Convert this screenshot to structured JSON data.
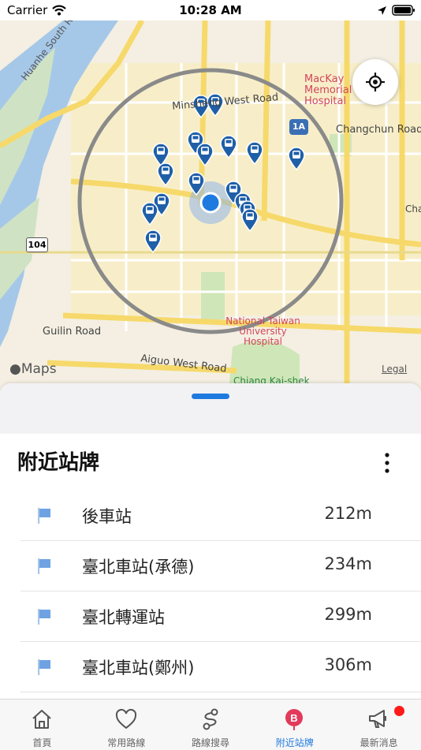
{
  "status_bar": {
    "carrier": "Carrier",
    "time": "10:28 AM"
  },
  "map": {
    "street_labels": [
      "Huanhe South Road",
      "Minsheng West Road",
      "MacKay Memorial Hospital",
      "Changchun Road",
      "Guilin Road",
      "Aiguo West Road",
      "National Taiwan University Hospital",
      "Chiang Kai-shek",
      "Cha"
    ],
    "route_shield": "104",
    "highway_shield": "1A",
    "attribution": "Maps",
    "legal": "Legal"
  },
  "sheet": {
    "title": "附近站牌",
    "stops": [
      {
        "name": "後車站",
        "distance": "212m"
      },
      {
        "name": "臺北車站(承德)",
        "distance": "234m"
      },
      {
        "name": "臺北轉運站",
        "distance": "299m"
      },
      {
        "name": "臺北車站(鄭州)",
        "distance": "306m"
      }
    ]
  },
  "tabs": [
    {
      "label": "首頁",
      "icon": "home-icon"
    },
    {
      "label": "常用路線",
      "icon": "heart-icon"
    },
    {
      "label": "路線搜尋",
      "icon": "route-icon"
    },
    {
      "label": "附近站牌",
      "icon": "bus-stop-icon"
    },
    {
      "label": "最新消息",
      "icon": "megaphone-icon"
    }
  ],
  "colors": {
    "accent": "#1f7ae0",
    "pin": "#1f5fa8",
    "river": "#a6c8e8",
    "badge": "#ff1a1a"
  }
}
